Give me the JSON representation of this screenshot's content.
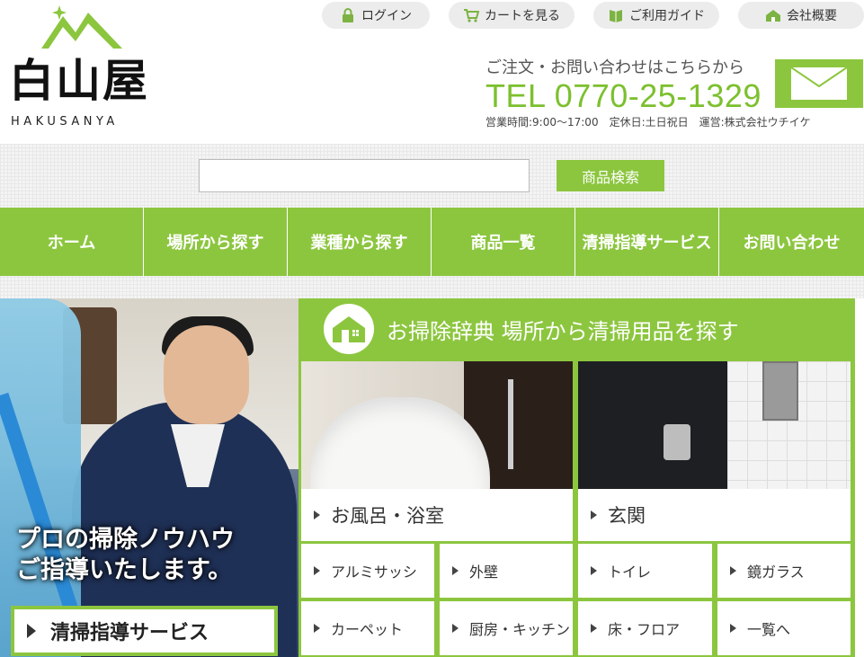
{
  "logo": {
    "kanji": "白山屋",
    "roman": "HAKUSANYA"
  },
  "toplinks": [
    {
      "label": "ログイン",
      "icon": "lock-icon"
    },
    {
      "label": "カートを見る",
      "icon": "cart-icon"
    },
    {
      "label": "ご利用ガイド",
      "icon": "book-icon"
    },
    {
      "label": "会社概要",
      "icon": "building-icon"
    }
  ],
  "contact": {
    "lead": "ご注文・お問い合わせはこちらから",
    "tel": "TEL 0770-25-1329",
    "hours": "営業時間:9:00～17:00　定休日:土日祝日　運営:株式会社ウチイケ"
  },
  "search": {
    "value": "",
    "button": "商品検索"
  },
  "nav": [
    "ホーム",
    "場所から探す",
    "業種から探す",
    "商品一覧",
    "清掃指導サービス",
    "お問い合わせ"
  ],
  "hero": {
    "copy_line1": "プロの掃除ノウハウ",
    "copy_line2": "ご指導いたします。",
    "button": "清掃指導サービス"
  },
  "dictionary": {
    "title": "お掃除辞典 場所から清掃用品を探す",
    "big": [
      "お風呂・浴室",
      "玄関"
    ],
    "small": [
      "アルミサッシ",
      "外壁",
      "トイレ",
      "鏡ガラス",
      "カーペット",
      "厨房・キッチン",
      "床・フロア",
      "一覧へ"
    ]
  },
  "colors": {
    "accent": "#8cc63f",
    "tel": "#7cc02e"
  }
}
